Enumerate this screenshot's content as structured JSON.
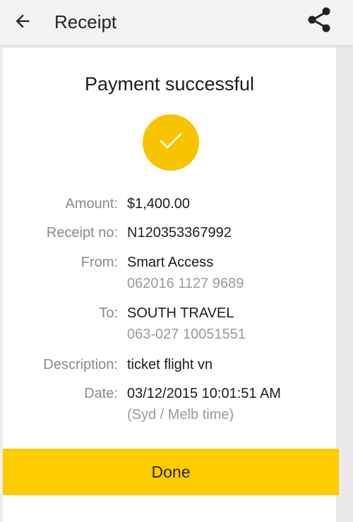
{
  "appbar": {
    "title": "Receipt",
    "back_icon": "arrow-back-icon",
    "share_icon": "share-icon"
  },
  "receipt": {
    "heading": "Payment successful",
    "status_icon": "check-icon",
    "accent_color": "#f8c400",
    "fields": {
      "amount": {
        "label": "Amount:",
        "value": "$1,400.00"
      },
      "receipt_no": {
        "label": "Receipt no:",
        "value": "N120353367992"
      },
      "from": {
        "label": "From:",
        "value": "Smart Access",
        "detail": "062016 1127 9689"
      },
      "to": {
        "label": "To:",
        "value": "SOUTH TRAVEL",
        "detail": "063-027 10051551"
      },
      "description": {
        "label": "Description:",
        "value": "ticket flight vn"
      },
      "date": {
        "label": "Date:",
        "value": "03/12/2015 10:01:51 AM",
        "detail": "(Syd / Melb time)"
      }
    }
  },
  "actions": {
    "done_label": "Done",
    "done_color": "#fccb00"
  }
}
